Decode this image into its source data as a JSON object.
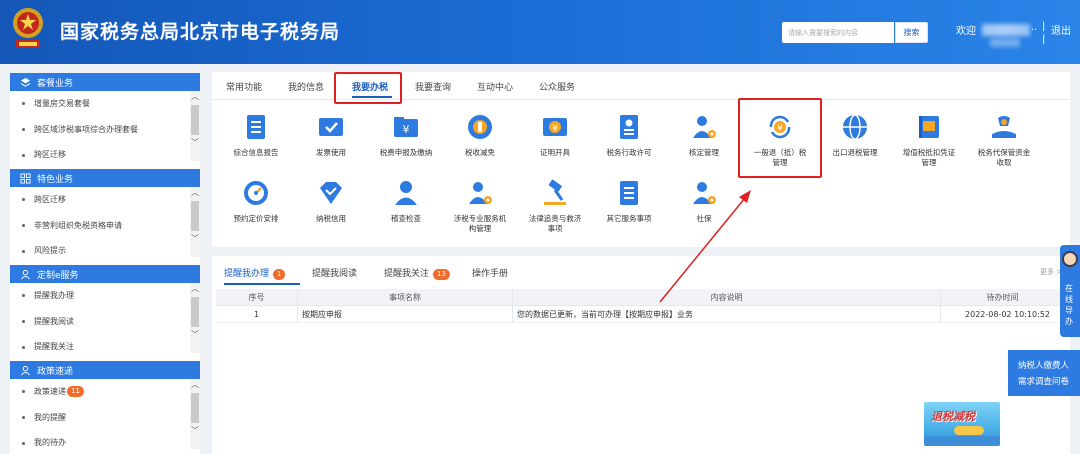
{
  "header": {
    "site_title": "国家税务总局北京市电子税务局",
    "search_placeholder": "请输入需要搜索的内容",
    "search_button": "搜索",
    "welcome": "欢迎",
    "user_name_mask": "..",
    "separator": "|",
    "logout": "退出"
  },
  "sidebar": {
    "groups": [
      {
        "title": "套餐业务",
        "icon": "layers-icon",
        "items": [
          "增量房交易套餐",
          "跨区域涉税事项综合办理套餐",
          "跨区迁移"
        ]
      },
      {
        "title": "特色业务",
        "icon": "grid-icon",
        "items": [
          "跨区迁移",
          "非营利组织免税资格申请",
          "风险提示"
        ]
      },
      {
        "title": "定制e服务",
        "icon": "user-icon",
        "items": [
          "提醒我办理",
          "提醒我阅读",
          "提醒我关注"
        ]
      },
      {
        "title": "政策速递",
        "icon": "user-icon",
        "items": [
          "政策速递",
          "我的提醒",
          "我的待办"
        ],
        "badge": "11"
      }
    ]
  },
  "main_tabs": {
    "items": [
      "常用功能",
      "我的信息",
      "我要办税",
      "我要查询",
      "互动中心",
      "公众服务"
    ],
    "active": "我要办税"
  },
  "functions": {
    "row1": [
      {
        "label": "综合信息报告",
        "icon": "document-list-icon"
      },
      {
        "label": "发票使用",
        "icon": "invoice-check-icon"
      },
      {
        "label": "税费申报及缴纳",
        "icon": "yuan-folder-icon"
      },
      {
        "label": "税收减免",
        "icon": "coin-icon"
      },
      {
        "label": "证明开具",
        "icon": "yuan-ticket-icon"
      },
      {
        "label": "税务行政许可",
        "icon": "id-card-icon"
      },
      {
        "label": "核定管理",
        "icon": "user-gear-icon"
      },
      {
        "label": "一般退（抵）税",
        "label2": "管理",
        "icon": "yuan-refresh-icon"
      },
      {
        "label": "出口退税管理",
        "icon": "globe-icon"
      },
      {
        "label": "增值税抵扣凭证",
        "label2": "管理",
        "icon": "stamp-book-icon"
      },
      {
        "label": "税务代保管资金",
        "label2": "收取",
        "icon": "money-hand-icon"
      }
    ],
    "row2": [
      {
        "label": "预约定价安排",
        "icon": "gauge-icon"
      },
      {
        "label": "纳税信用",
        "icon": "diamond-icon"
      },
      {
        "label": "稽查检查",
        "icon": "person-icon"
      },
      {
        "label": "涉税专业服务机",
        "label2": "构管理",
        "icon": "user-gear-icon"
      },
      {
        "label": "法律追责与救济",
        "label2": "事项",
        "icon": "gavel-icon"
      },
      {
        "label": "其它服务事项",
        "icon": "document-list-icon"
      },
      {
        "label": "社保",
        "icon": "user-gear-icon"
      }
    ]
  },
  "bottom_tabs": {
    "items": [
      {
        "label": "提醒我办理",
        "badge": "1"
      },
      {
        "label": "提醒我阅读",
        "badge": ""
      },
      {
        "label": "提醒我关注",
        "badge": "13"
      },
      {
        "label": "操作手册",
        "badge": ""
      }
    ],
    "more": "更多 >"
  },
  "table": {
    "headers": [
      "序号",
      "事项名称",
      "内容说明",
      "待办时间"
    ],
    "rows": [
      [
        "1",
        "按期应申报",
        "您的数据已更新，当前可办理【按期应申报】业务",
        "2022-08-02 10:10:52"
      ]
    ]
  },
  "floating": {
    "online_guide": "在线导办",
    "survey_line1": "纳税人缴费人",
    "survey_line2": "需求调查问卷",
    "promo_title": "退税减税",
    "promo_sub": "详情点击"
  },
  "colors": {
    "brand_blue": "#1a5fc4",
    "header_blue": "#1a6bd3",
    "highlight_red": "#e02020",
    "badge_orange": "#f26b29"
  }
}
